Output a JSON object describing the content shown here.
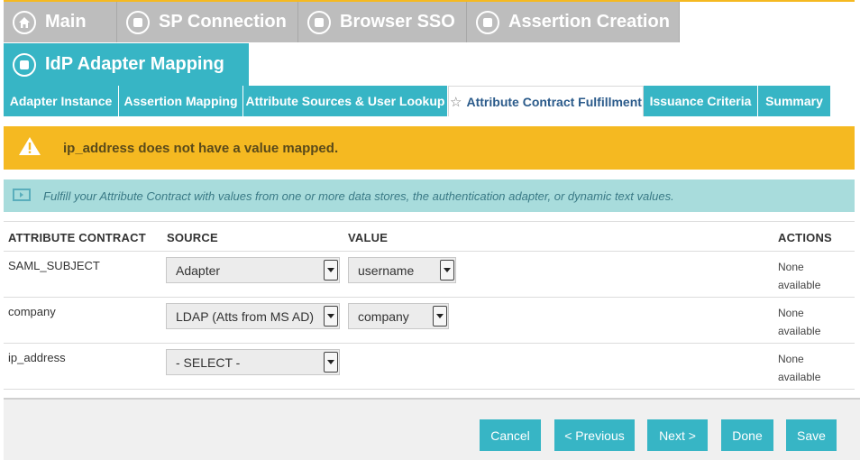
{
  "top_tabs": [
    {
      "label": "Main",
      "icon": "home-icon"
    },
    {
      "label": "SP Connection",
      "icon": "stop-circle-icon"
    },
    {
      "label": "Browser SSO",
      "icon": "stop-circle-icon"
    },
    {
      "label": "Assertion Creation",
      "icon": "stop-circle-icon"
    }
  ],
  "second_tab": {
    "label": "IdP Adapter Mapping",
    "icon": "stop-circle-icon"
  },
  "sub_tabs": [
    {
      "label": "Adapter Instance"
    },
    {
      "label": "Assertion Mapping"
    },
    {
      "label": "Attribute Sources & User Lookup"
    },
    {
      "label": "Attribute Contract Fulfillment",
      "active": true
    },
    {
      "label": "Issuance Criteria"
    },
    {
      "label": "Summary"
    }
  ],
  "warning": {
    "text": "ip_address does not have a value mapped.",
    "icon": "warning-triangle-icon"
  },
  "info": {
    "text": "Fulfill your Attribute Contract with values from one or more data stores, the authentication adapter, or dynamic text values.",
    "icon": "info-screen-icon"
  },
  "table": {
    "headers": {
      "contract": "ATTRIBUTE CONTRACT",
      "source": "SOURCE",
      "value": "VALUE",
      "actions": "ACTIONS"
    },
    "rows": [
      {
        "name": "SAML_SUBJECT",
        "source": "Adapter",
        "value": "username",
        "actions": "None available"
      },
      {
        "name": "company",
        "source": "LDAP (Atts from MS AD)",
        "value": "company",
        "actions": "None available"
      },
      {
        "name": "ip_address",
        "source": "- SELECT -",
        "value": "",
        "actions": "None available"
      }
    ]
  },
  "buttons": {
    "cancel": "Cancel",
    "previous": "< Previous",
    "next": "Next >",
    "done": "Done",
    "save": "Save"
  },
  "colors": {
    "accent": "#37b5c5",
    "warning": "#f5b921",
    "info": "#a8dcdc",
    "inactive_tab": "#bdbdbd"
  }
}
